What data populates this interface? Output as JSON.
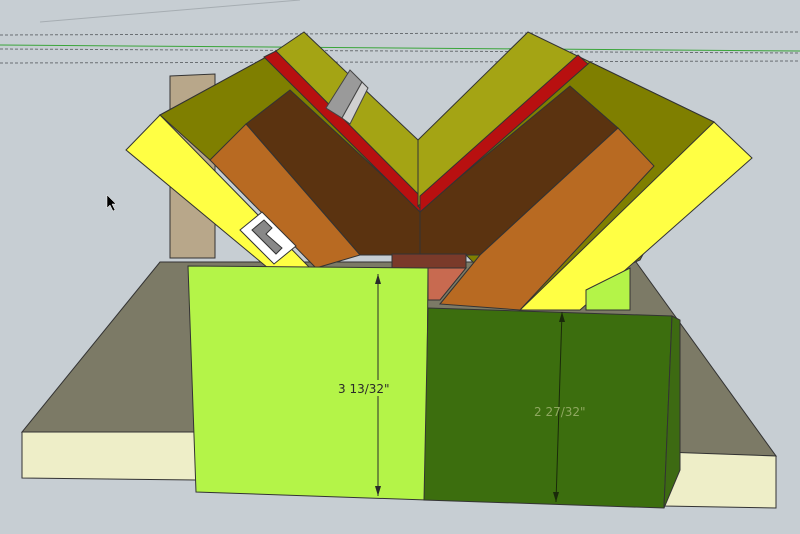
{
  "dimensions": {
    "left_panel_height": "3 13/32\"",
    "right_panel_height": "2 27/32\""
  },
  "colors": {
    "background": "#c7ced3",
    "table_top": "#7c7a66",
    "table_edge": "#eeeec8",
    "back_block": "#b8a78a",
    "olive_light": "#a4a414",
    "olive_dark": "#7f7f00",
    "yellow": "#ffff44",
    "brown_dark": "#5b3310",
    "brown_light": "#b86a22",
    "red_groove": "#b81010",
    "lime_panel": "#b4f448",
    "green_panel": "#3c6e0e",
    "cursor": "#000000"
  }
}
